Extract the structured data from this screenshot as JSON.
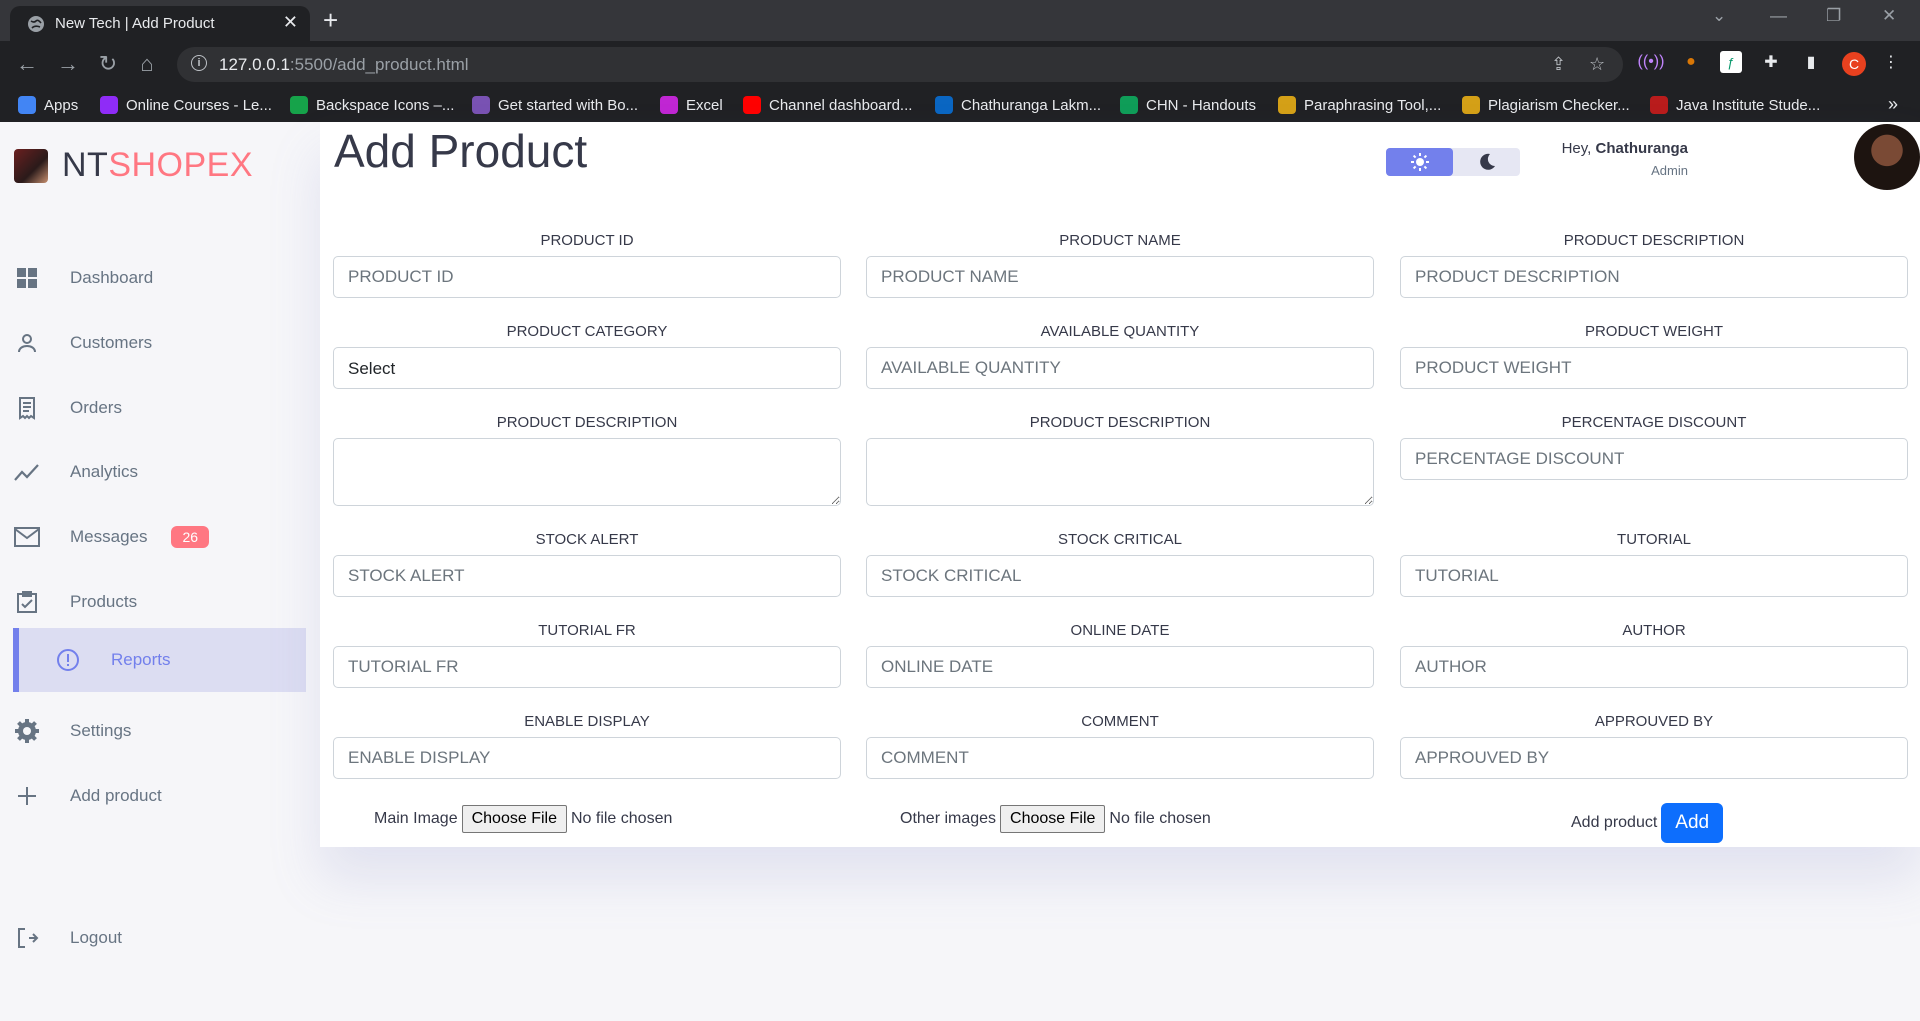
{
  "browser": {
    "tab_title": "New Tech | Add Product",
    "url_host": "127.0.0.1",
    "url_path": ":5500/add_product.html",
    "profile_initial": "C",
    "bookmarks": [
      {
        "label": "Apps",
        "color": "#4285f4"
      },
      {
        "label": "Online Courses - Le...",
        "color": "#8f2cf7"
      },
      {
        "label": "Backspace Icons –...",
        "color": "#16a34a"
      },
      {
        "label": "Get started with Bo...",
        "color": "#7952b3"
      },
      {
        "label": "Excel",
        "color": "#c026d3"
      },
      {
        "label": "Channel dashboard...",
        "color": "#ff0000"
      },
      {
        "label": "Chathuranga Lakm...",
        "color": "#0a66c2"
      },
      {
        "label": "CHN - Handouts",
        "color": "#0f9d58"
      },
      {
        "label": "Paraphrasing Tool,...",
        "color": "#d4a017"
      },
      {
        "label": "Plagiarism Checker...",
        "color": "#d4a017"
      },
      {
        "label": "Java Institute Stude...",
        "color": "#b91c1c"
      }
    ]
  },
  "brand": {
    "prefix": "NT",
    "accent": "SHOPEX"
  },
  "sidebar": {
    "items": [
      {
        "label": "Dashboard",
        "icon": "grid-icon"
      },
      {
        "label": "Customers",
        "icon": "person-icon"
      },
      {
        "label": "Orders",
        "icon": "receipt-icon"
      },
      {
        "label": "Analytics",
        "icon": "chart-icon"
      },
      {
        "label": "Messages",
        "icon": "mail-icon",
        "badge": "26"
      },
      {
        "label": "Products",
        "icon": "clipboard-icon"
      },
      {
        "label": "Reports",
        "icon": "alert-icon",
        "active": true
      },
      {
        "label": "Settings",
        "icon": "gear-icon"
      },
      {
        "label": "Add product",
        "icon": "plus-icon"
      }
    ],
    "logout": "Logout"
  },
  "header": {
    "title": "Add Product",
    "greeting_prefix": "Hey, ",
    "user_name": "Chathuranga",
    "role": "Admin"
  },
  "form": {
    "fields": [
      {
        "label": "PRODUCT ID",
        "placeholder": "PRODUCT ID",
        "type": "input"
      },
      {
        "label": "PRODUCT NAME",
        "placeholder": "PRODUCT NAME",
        "type": "input"
      },
      {
        "label": "PRODUCT DESCRIPTION",
        "placeholder": "PRODUCT DESCRIPTION",
        "type": "input"
      },
      {
        "label": "PRODUCT CATEGORY",
        "value": "Select",
        "type": "select"
      },
      {
        "label": "AVAILABLE QUANTITY",
        "placeholder": "AVAILABLE QUANTITY",
        "type": "input"
      },
      {
        "label": "PRODUCT WEIGHT",
        "placeholder": "PRODUCT WEIGHT",
        "type": "input"
      },
      {
        "label": "PRODUCT DESCRIPTION",
        "placeholder": "",
        "type": "textarea"
      },
      {
        "label": "PRODUCT DESCRIPTION",
        "placeholder": "",
        "type": "textarea"
      },
      {
        "label": "PERCENTAGE DISCOUNT",
        "placeholder": "PERCENTAGE DISCOUNT",
        "type": "input"
      },
      {
        "label": "STOCK ALERT",
        "placeholder": "STOCK ALERT",
        "type": "input"
      },
      {
        "label": "STOCK CRITICAL",
        "placeholder": "STOCK CRITICAL",
        "type": "input"
      },
      {
        "label": "TUTORIAL",
        "placeholder": "TUTORIAL",
        "type": "input"
      },
      {
        "label": "TUTORIAL FR",
        "placeholder": "TUTORIAL FR",
        "type": "input"
      },
      {
        "label": "ONLINE DATE",
        "placeholder": "ONLINE DATE",
        "type": "input"
      },
      {
        "label": "AUTHOR",
        "placeholder": "AUTHOR",
        "type": "input"
      },
      {
        "label": "ENABLE DISPLAY",
        "placeholder": "ENABLE DISPLAY",
        "type": "input"
      },
      {
        "label": "COMMENT",
        "placeholder": "COMMENT",
        "type": "input"
      },
      {
        "label": "APPROUVED BY",
        "placeholder": "APPROUVED BY",
        "type": "input"
      }
    ],
    "main_image_label": "Main Image",
    "other_images_label": "Other images",
    "choose_file": "Choose File",
    "no_file": "No file chosen",
    "add_product_label": "Add product",
    "add_button": "Add"
  },
  "colors": {
    "primary": "#7380ec",
    "danger": "#ff7782",
    "button": "#0d6efd"
  }
}
